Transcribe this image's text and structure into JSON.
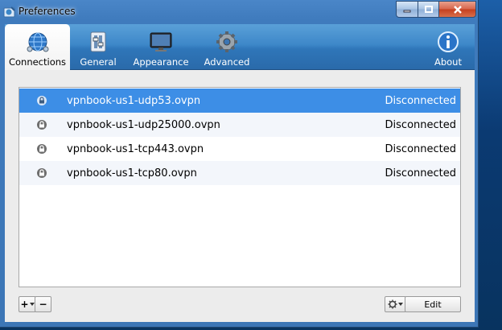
{
  "window": {
    "title": "Preferences"
  },
  "toolbar": {
    "tabs": [
      {
        "label": "Connections",
        "icon": "globe-network-icon",
        "active": true
      },
      {
        "label": "General",
        "icon": "switch-panel-icon",
        "active": false
      },
      {
        "label": "Appearance",
        "icon": "monitor-icon",
        "active": false
      },
      {
        "label": "Advanced",
        "icon": "gear-icon",
        "active": false
      }
    ],
    "about_label": "About"
  },
  "connections": [
    {
      "name": "vpnbook-us1-udp53.ovpn",
      "status": "Disconnected",
      "selected": true
    },
    {
      "name": "vpnbook-us1-udp25000.ovpn",
      "status": "Disconnected",
      "selected": false
    },
    {
      "name": "vpnbook-us1-tcp443.ovpn",
      "status": "Disconnected",
      "selected": false
    },
    {
      "name": "vpnbook-us1-tcp80.ovpn",
      "status": "Disconnected",
      "selected": false
    }
  ],
  "buttons": {
    "add": "+",
    "remove": "−",
    "edit": "Edit"
  },
  "colors": {
    "selection": "#3d8ee6",
    "toolbar": "#3e88c9"
  }
}
